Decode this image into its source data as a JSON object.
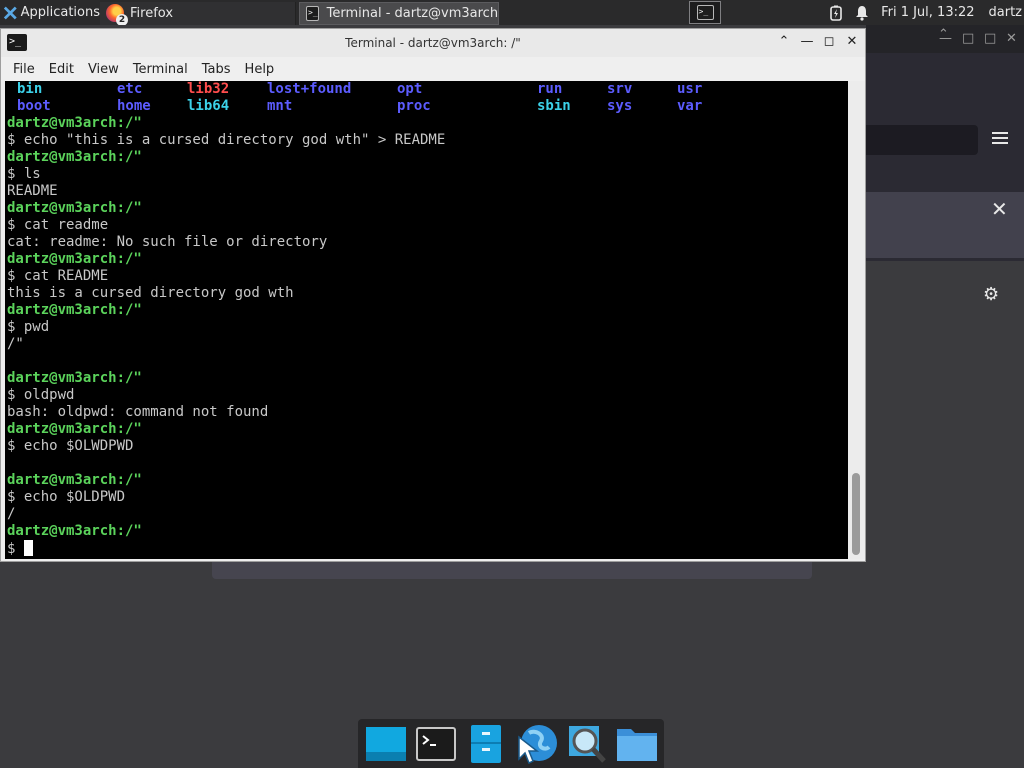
{
  "top_panel": {
    "applications_label": "Applications",
    "tasks": [
      {
        "label": "Firefox",
        "badge": "2"
      },
      {
        "label": "Terminal - dartz@vm3arch: /\""
      }
    ],
    "clock": "Fri 1 Jul, 13:22",
    "user": "dartz"
  },
  "terminal": {
    "title": "Terminal - dartz@vm3arch: /\"",
    "menu": [
      "File",
      "Edit",
      "View",
      "Terminal",
      "Tabs",
      "Help"
    ],
    "ls_rows": [
      [
        {
          "text": "bin",
          "type": "lnk"
        },
        {
          "text": "etc",
          "type": "dir"
        },
        {
          "text": "lib32",
          "type": "bad"
        },
        {
          "text": "lost+found",
          "type": "dir"
        },
        {
          "text": "opt",
          "type": "dir"
        },
        {
          "text": "run",
          "type": "dir"
        },
        {
          "text": "srv",
          "type": "dir"
        },
        {
          "text": "usr",
          "type": "dir"
        }
      ],
      [
        {
          "text": "boot",
          "type": "dir"
        },
        {
          "text": "home",
          "type": "dir"
        },
        {
          "text": "lib64",
          "type": "lnk"
        },
        {
          "text": "mnt",
          "type": "dir"
        },
        {
          "text": "proc",
          "type": "dir"
        },
        {
          "text": "sbin",
          "type": "lnk"
        },
        {
          "text": "sys",
          "type": "dir"
        },
        {
          "text": "var",
          "type": "dir"
        }
      ]
    ],
    "lines": [
      {
        "kind": "prompt",
        "text": "dartz@vm3arch:/\""
      },
      {
        "kind": "cmd",
        "text": "$ echo \"this is a cursed directory god wth\" > README"
      },
      {
        "kind": "prompt",
        "text": "dartz@vm3arch:/\""
      },
      {
        "kind": "cmd",
        "text": "$ ls"
      },
      {
        "kind": "out",
        "text": "README"
      },
      {
        "kind": "prompt",
        "text": "dartz@vm3arch:/\""
      },
      {
        "kind": "cmd",
        "text": "$ cat readme"
      },
      {
        "kind": "out",
        "text": "cat: readme: No such file or directory"
      },
      {
        "kind": "prompt",
        "text": "dartz@vm3arch:/\""
      },
      {
        "kind": "cmd",
        "text": "$ cat README"
      },
      {
        "kind": "out",
        "text": "this is a cursed directory god wth"
      },
      {
        "kind": "prompt",
        "text": "dartz@vm3arch:/\""
      },
      {
        "kind": "cmd",
        "text": "$ pwd"
      },
      {
        "kind": "out",
        "text": "/\""
      },
      {
        "kind": "out",
        "text": ""
      },
      {
        "kind": "prompt",
        "text": "dartz@vm3arch:/\""
      },
      {
        "kind": "cmd",
        "text": "$ oldpwd"
      },
      {
        "kind": "out",
        "text": "bash: oldpwd: command not found"
      },
      {
        "kind": "prompt",
        "text": "dartz@vm3arch:/\""
      },
      {
        "kind": "cmd",
        "text": "$ echo $OLWDPWD"
      },
      {
        "kind": "out",
        "text": ""
      },
      {
        "kind": "prompt",
        "text": "dartz@vm3arch:/\""
      },
      {
        "kind": "cmd",
        "text": "$ echo $OLDPWD"
      },
      {
        "kind": "out",
        "text": "/"
      },
      {
        "kind": "prompt",
        "text": "dartz@vm3arch:/\""
      }
    ],
    "current_input": "$ "
  },
  "dock": [
    {
      "icon": "desktop-icon"
    },
    {
      "icon": "terminal-icon"
    },
    {
      "icon": "file-cabinet-icon"
    },
    {
      "icon": "web-browser-icon"
    },
    {
      "icon": "app-finder-icon"
    },
    {
      "icon": "folder-icon"
    }
  ],
  "colors": {
    "dir": "#5c5cff",
    "link": "#3cd1e8",
    "broken": "#ff4d4d",
    "prompt": "#5bd35b"
  }
}
